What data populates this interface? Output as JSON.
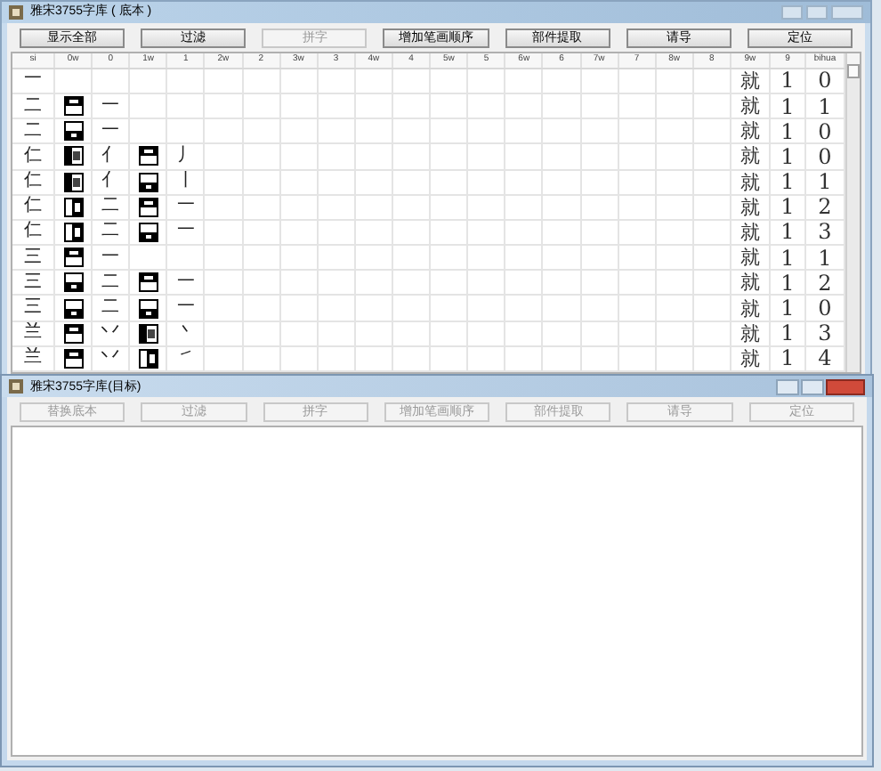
{
  "main_window": {
    "title": "雅宋3755字库 ( 底本 )",
    "buttons": [
      {
        "label": "显示全部",
        "disabled": false
      },
      {
        "label": "过滤",
        "disabled": false
      },
      {
        "label": "拼字",
        "disabled": true
      },
      {
        "label": "增加笔画顺序",
        "disabled": false
      },
      {
        "label": "部件提取",
        "disabled": false
      },
      {
        "label": "请导",
        "disabled": false
      },
      {
        "label": "定位",
        "disabled": false
      }
    ],
    "table": {
      "columns": [
        "si",
        "0w",
        "0",
        "1w",
        "1",
        "2w",
        "2",
        "3w",
        "3",
        "4w",
        "4",
        "5w",
        "5",
        "6w",
        "6",
        "7w",
        "7",
        "8w",
        "8",
        "9w",
        "9",
        "bihua"
      ],
      "rows": [
        {
          "si": "一",
          "parts": [],
          "col_9w": "就",
          "col_9": "1",
          "bihua": "0"
        },
        {
          "si": "二",
          "parts": [
            {
              "kind": "top",
              "char": "一"
            }
          ],
          "col_9w": "就",
          "col_9": "1",
          "bihua": "1"
        },
        {
          "si": "二",
          "parts": [
            {
              "kind": "bottom",
              "char": "一"
            }
          ],
          "col_9w": "就",
          "col_9": "1",
          "bihua": "0"
        },
        {
          "si": "仁",
          "parts": [
            {
              "kind": "left",
              "char": "亻"
            },
            {
              "kind": "top",
              "char": "丿"
            }
          ],
          "col_9w": "就",
          "col_9": "1",
          "bihua": "0"
        },
        {
          "si": "仁",
          "parts": [
            {
              "kind": "left",
              "char": "亻"
            },
            {
              "kind": "bottom",
              "char": "丨"
            }
          ],
          "col_9w": "就",
          "col_9": "1",
          "bihua": "1"
        },
        {
          "si": "仁",
          "parts": [
            {
              "kind": "right",
              "char": "二"
            },
            {
              "kind": "top",
              "char": "一"
            }
          ],
          "col_9w": "就",
          "col_9": "1",
          "bihua": "2"
        },
        {
          "si": "仁",
          "parts": [
            {
              "kind": "right",
              "char": "二"
            },
            {
              "kind": "bottom",
              "char": "一"
            }
          ],
          "col_9w": "就",
          "col_9": "1",
          "bihua": "3"
        },
        {
          "si": "三",
          "parts": [
            {
              "kind": "top",
              "char": "一"
            }
          ],
          "col_9w": "就",
          "col_9": "1",
          "bihua": "1"
        },
        {
          "si": "三",
          "parts": [
            {
              "kind": "bottom",
              "char": "二"
            },
            {
              "kind": "top",
              "char": "一"
            }
          ],
          "col_9w": "就",
          "col_9": "1",
          "bihua": "2"
        },
        {
          "si": "三",
          "parts": [
            {
              "kind": "bottom",
              "char": "二"
            },
            {
              "kind": "bottom",
              "char": "一"
            }
          ],
          "col_9w": "就",
          "col_9": "1",
          "bihua": "0"
        },
        {
          "si": "兰",
          "parts": [
            {
              "kind": "top",
              "char": "丷"
            },
            {
              "kind": "left",
              "char": "丶"
            }
          ],
          "col_9w": "就",
          "col_9": "1",
          "bihua": "3"
        },
        {
          "si": "兰",
          "parts": [
            {
              "kind": "top",
              "char": "丷"
            },
            {
              "kind": "right",
              "char": "㇀"
            }
          ],
          "col_9w": "就",
          "col_9": "1",
          "bihua": "4"
        }
      ]
    }
  },
  "second_window": {
    "title": "雅宋3755字库(目标)",
    "buttons": [
      {
        "label": "替换底本",
        "disabled": true
      },
      {
        "label": "过滤",
        "disabled": true
      },
      {
        "label": "拼字",
        "disabled": true
      },
      {
        "label": "增加笔画顺序",
        "disabled": true
      },
      {
        "label": "部件提取",
        "disabled": true
      },
      {
        "label": "请导",
        "disabled": true
      },
      {
        "label": "定位",
        "disabled": true
      }
    ]
  }
}
